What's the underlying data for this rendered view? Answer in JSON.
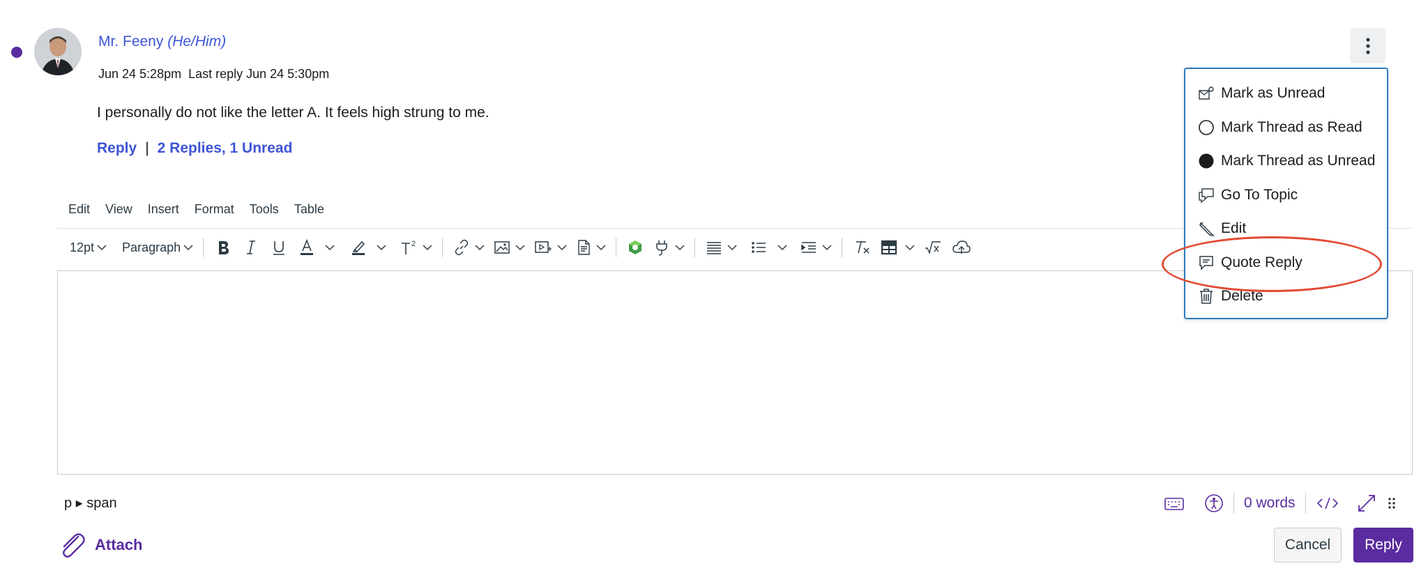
{
  "post": {
    "author_name": "Mr. Feeny",
    "author_pronouns": "(He/Him)",
    "meta": "Jun 24 5:28pm  Last reply Jun 24 5:30pm",
    "body": "I personally do not like the letter A. It feels high strung to me.",
    "reply_link": "Reply",
    "separator": "|",
    "replies_link": "2 Replies, 1 Unread"
  },
  "editor": {
    "menubar": [
      "Edit",
      "View",
      "Insert",
      "Format",
      "Tools",
      "Table"
    ],
    "font_size": "12pt",
    "block_format": "Paragraph",
    "path": "p ▸ span",
    "word_count": "0 words"
  },
  "footer": {
    "attach_label": "Attach",
    "cancel_label": "Cancel",
    "reply_label": "Reply"
  },
  "context_menu": {
    "items": [
      "Mark as Unread",
      "Mark Thread as Read",
      "Mark Thread as Unread",
      "Go To Topic",
      "Edit",
      "Quote Reply",
      "Delete"
    ]
  },
  "colors": {
    "brand": "#5a2ca0",
    "link": "#3d55d6",
    "focus": "#2b7abc",
    "annotation": "#e24a32"
  },
  "icons": [
    "mark-unread-icon",
    "circle-outline-icon",
    "circle-filled-icon",
    "go-to-topic-icon",
    "pencil-icon",
    "quote-icon",
    "trash-icon",
    "kebab-icon",
    "paperclip-icon"
  ]
}
